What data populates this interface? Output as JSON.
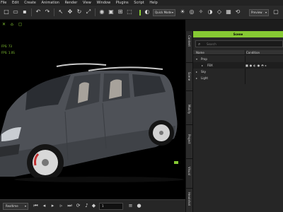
{
  "menu": {
    "items": [
      "File",
      "Edit",
      "Create",
      "Animation",
      "Render",
      "View",
      "Window",
      "Plugins",
      "Script",
      "Help"
    ]
  },
  "toolbar": {
    "mode_select": "Quick Mode",
    "preview_select": "Preview",
    "icons": [
      "new-file",
      "open",
      "save",
      "undo",
      "redo",
      "pointer",
      "move",
      "rotate",
      "scale",
      "camera",
      "render",
      "grid",
      "light",
      "sun",
      "reset"
    ]
  },
  "viewport": {
    "icons": [
      "axis-icon",
      "vertex-icon",
      "camera-icon"
    ],
    "stats": [
      "FPS: 73",
      "FPS: 1.0S"
    ]
  },
  "playback": {
    "mode": "Realtime",
    "frame": "1"
  },
  "side_tabs": [
    "Content",
    "Scene",
    "Modify",
    "Project",
    "Visual",
    "Headshot"
  ],
  "scene_panel": {
    "title": "Scene",
    "search_placeholder": "Search",
    "columns": [
      "Name",
      "Condition"
    ],
    "tree": [
      {
        "label": "Prop",
        "level": 0,
        "expanded": true
      },
      {
        "label": "FBX",
        "level": 1,
        "expanded": false
      },
      {
        "label": "Sky",
        "level": 0,
        "expanded": false
      },
      {
        "label": "Light",
        "level": 0,
        "expanded": false
      }
    ]
  },
  "colors": {
    "accent": "#86c933",
    "car_body": "#4e5157"
  }
}
